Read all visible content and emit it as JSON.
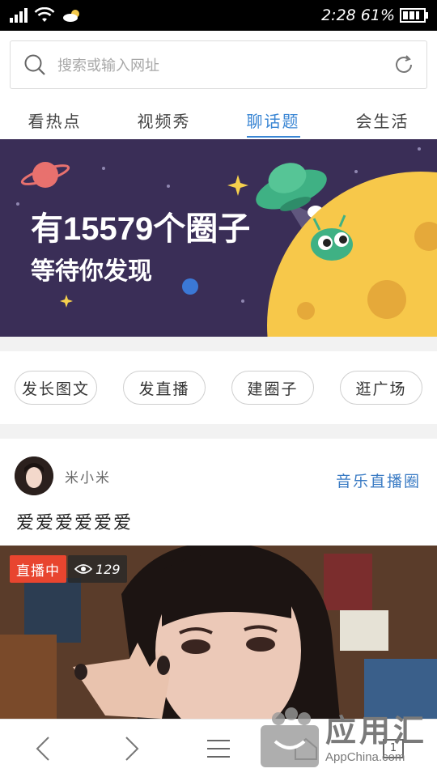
{
  "status_bar": {
    "time": "2:28",
    "battery": "61%"
  },
  "search": {
    "placeholder": "搜索或输入网址"
  },
  "tabs": [
    {
      "label": "看热点",
      "active": false
    },
    {
      "label": "视频秀",
      "active": false
    },
    {
      "label": "聊话题",
      "active": true
    },
    {
      "label": "会生活",
      "active": false
    }
  ],
  "banner": {
    "title": "有15579个圈子",
    "subtitle": "等待你发现"
  },
  "actions": [
    {
      "label": "发长图文"
    },
    {
      "label": "发直播"
    },
    {
      "label": "建圈子"
    },
    {
      "label": "逛广场"
    }
  ],
  "post": {
    "username": "米小米",
    "circle": "音乐直播圈",
    "text": "爱爱爱爱爱爱",
    "live_badge": "直播中",
    "viewers": "129"
  },
  "bottom_nav": {
    "tab_count": "1"
  },
  "watermark": {
    "main": "应用汇",
    "sub": "AppChina.com"
  },
  "colors": {
    "accent": "#3a86d4",
    "banner_bg": "#3a2e57",
    "live_red": "#e8452f",
    "planet_yellow": "#f7c84a"
  }
}
